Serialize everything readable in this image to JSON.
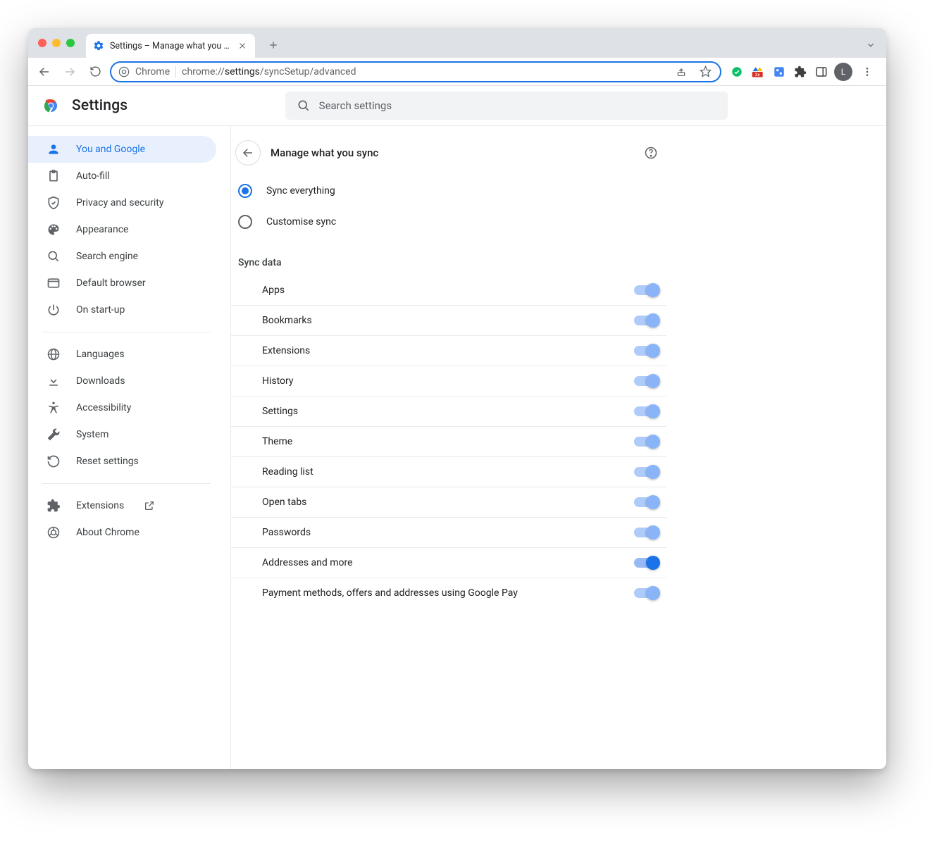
{
  "tab": {
    "title": "Settings – Manage what you sy"
  },
  "omnibox": {
    "prefix": "Chrome",
    "url_prefix": "chrome://",
    "url_bold": "settings",
    "url_rest": "/syncSetup/advanced"
  },
  "avatar_initial": "L",
  "header": {
    "title": "Settings",
    "search_placeholder": "Search settings"
  },
  "sidebar": {
    "items": [
      {
        "label": "You and Google",
        "icon": "person",
        "active": true
      },
      {
        "label": "Auto-fill",
        "icon": "clipboard"
      },
      {
        "label": "Privacy and security",
        "icon": "shield"
      },
      {
        "label": "Appearance",
        "icon": "palette"
      },
      {
        "label": "Search engine",
        "icon": "search"
      },
      {
        "label": "Default browser",
        "icon": "browser"
      },
      {
        "label": "On start-up",
        "icon": "power"
      }
    ],
    "group2": [
      {
        "label": "Languages",
        "icon": "globe"
      },
      {
        "label": "Downloads",
        "icon": "download"
      },
      {
        "label": "Accessibility",
        "icon": "accessibility"
      },
      {
        "label": "System",
        "icon": "wrench"
      },
      {
        "label": "Reset settings",
        "icon": "restore"
      }
    ],
    "group3": [
      {
        "label": "Extensions",
        "icon": "puzzle",
        "external": true
      },
      {
        "label": "About Chrome",
        "icon": "chrome"
      }
    ]
  },
  "panel": {
    "title": "Manage what you sync",
    "radio_sync_everything": "Sync everything",
    "radio_customise": "Customise sync",
    "section_label": "Sync data",
    "rows": [
      {
        "label": "Apps"
      },
      {
        "label": "Bookmarks"
      },
      {
        "label": "Extensions"
      },
      {
        "label": "History"
      },
      {
        "label": "Settings"
      },
      {
        "label": "Theme"
      },
      {
        "label": "Reading list"
      },
      {
        "label": "Open tabs"
      },
      {
        "label": "Passwords"
      },
      {
        "label": "Addresses and more",
        "full": true
      },
      {
        "label": "Payment methods, offers and addresses using Google Pay"
      }
    ]
  }
}
